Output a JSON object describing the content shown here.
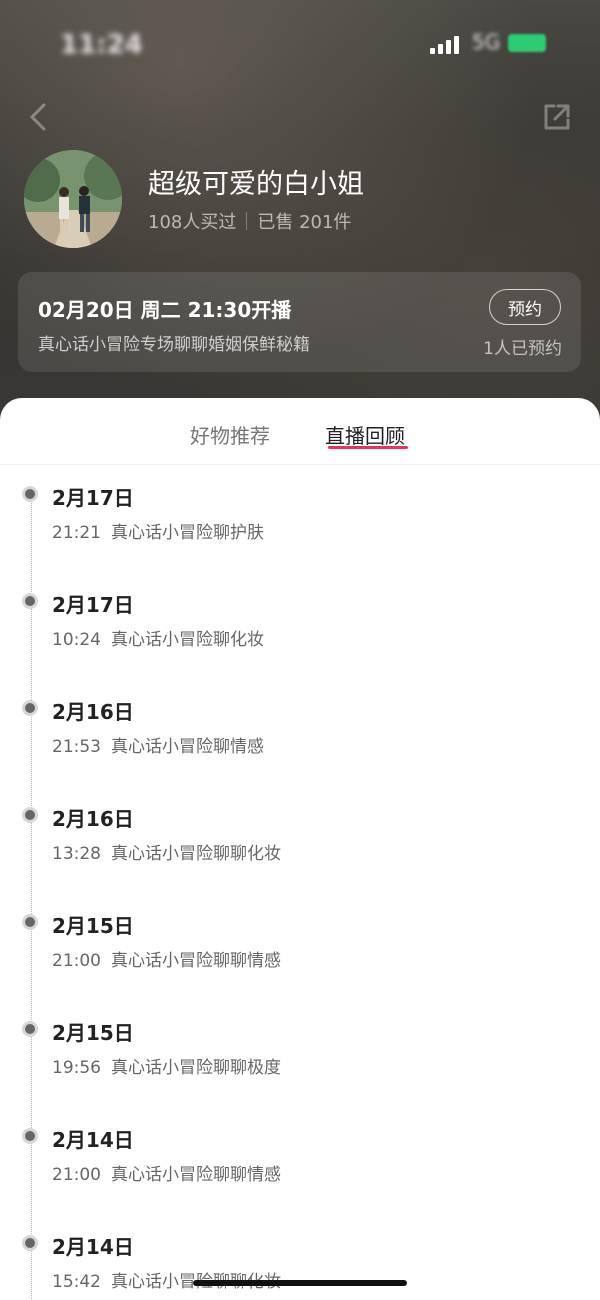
{
  "status_bar": {
    "time": "11:24",
    "network": "5G"
  },
  "icons": {
    "back": "back-chevron-icon",
    "share": "share-icon",
    "signal": "signal-icon",
    "battery": "battery-icon"
  },
  "profile": {
    "name": "超级可爱的白小姐",
    "bought": "108人买过",
    "sold": "已售 201件"
  },
  "live": {
    "time": "02月20日 周二 21:30开播",
    "topic": "真心话小冒险专场聊聊婚姻保鲜秘籍",
    "reserve_label": "预约",
    "reserve_count": "1人已预约"
  },
  "tabs": [
    {
      "label": "好物推荐",
      "active": false
    },
    {
      "label": "直播回顾",
      "active": true
    }
  ],
  "colors": {
    "accent": "#e8345a",
    "header_bg": "#3a3834"
  },
  "replays": [
    {
      "date": "2月17日",
      "time": "21:21",
      "title": "真心话小冒险聊护肤"
    },
    {
      "date": "2月17日",
      "time": "10:24",
      "title": "真心话小冒险聊化妆"
    },
    {
      "date": "2月16日",
      "time": "21:53",
      "title": "真心话小冒险聊情感"
    },
    {
      "date": "2月16日",
      "time": "13:28",
      "title": "真心话小冒险聊聊化妆"
    },
    {
      "date": "2月15日",
      "time": "21:00",
      "title": "真心话小冒险聊聊情感"
    },
    {
      "date": "2月15日",
      "time": "19:56",
      "title": "真心话小冒险聊聊极度"
    },
    {
      "date": "2月14日",
      "time": "21:00",
      "title": "真心话小冒险聊聊情感"
    },
    {
      "date": "2月14日",
      "time": "15:42",
      "title": "真心话小冒险聊聊化妆"
    }
  ]
}
